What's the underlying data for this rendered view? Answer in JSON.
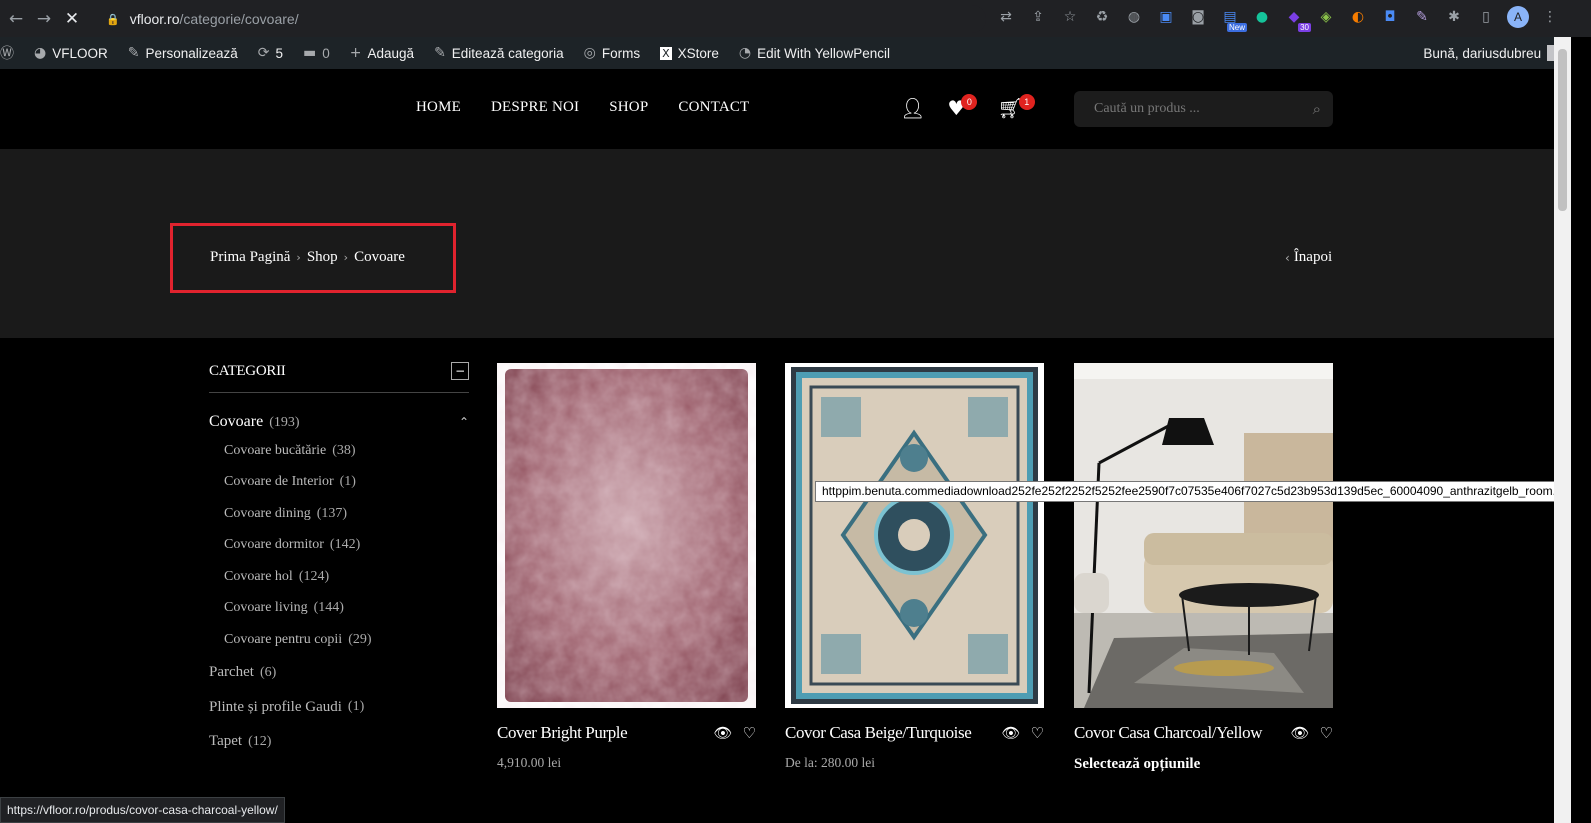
{
  "browser": {
    "url_host": "vfloor.ro",
    "url_path": "/categorie/covoare/",
    "extension_badges": {
      "new": "New",
      "count": "30"
    },
    "profile_initial": "A"
  },
  "adminbar": {
    "site": "VFLOOR",
    "customize": "Personalizează",
    "updates": "5",
    "comments": "0",
    "add": "Adaugă",
    "edit_category": "Editează categoria",
    "forms": "Forms",
    "xstore": "XStore",
    "yellowpencil": "Edit With YellowPencil",
    "greeting": "Bună, dariusdubreu"
  },
  "header": {
    "menu": [
      "HOME",
      "DESPRE NOI",
      "SHOP",
      "CONTACT"
    ],
    "wishlist_count": "0",
    "cart_count": "1",
    "search_placeholder": "Caută un produs ..."
  },
  "breadcrumb": {
    "items": [
      "Prima Pagină",
      "Shop",
      "Covoare"
    ],
    "back": "Înapoi"
  },
  "sidebar": {
    "title": "CATEGORII",
    "main": {
      "label": "Covoare",
      "count": "(193)"
    },
    "subs": [
      {
        "label": "Covoare bucătărie",
        "count": "(38)"
      },
      {
        "label": "Covoare de Interior",
        "count": "(1)"
      },
      {
        "label": "Covoare dining",
        "count": "(137)"
      },
      {
        "label": "Covoare dormitor",
        "count": "(142)"
      },
      {
        "label": "Covoare hol",
        "count": "(124)"
      },
      {
        "label": "Covoare living",
        "count": "(144)"
      },
      {
        "label": "Covoare pentru copii",
        "count": "(29)"
      }
    ],
    "others": [
      {
        "label": "Parchet",
        "count": "(6)"
      },
      {
        "label": "Plinte și profile Gaudi",
        "count": "(1)"
      },
      {
        "label": "Tapet",
        "count": "(12)"
      }
    ]
  },
  "products": [
    {
      "title": "Cover Bright Purple",
      "price": "4,910.00 lei"
    },
    {
      "title": "Covor Casa Beige/Turquoise",
      "price": "De la: 280.00 lei"
    },
    {
      "title": "Covor Casa Charcoal/Yellow",
      "option": "Selectează opțiunile"
    }
  ],
  "tooltip": "httppim.benuta.commediadownload252fe252f2252f5252fee2590f7c07535e406f7027c5d23b953d139d5ec_60004090_anthrazitgelb_room.jpg",
  "status_url": "https://vfloor.ro/produs/covor-casa-charcoal-yellow/",
  "colors": {
    "accent_red": "#e0231f",
    "banner_bg": "#1a1a1a",
    "highlight": "#e0232e"
  }
}
